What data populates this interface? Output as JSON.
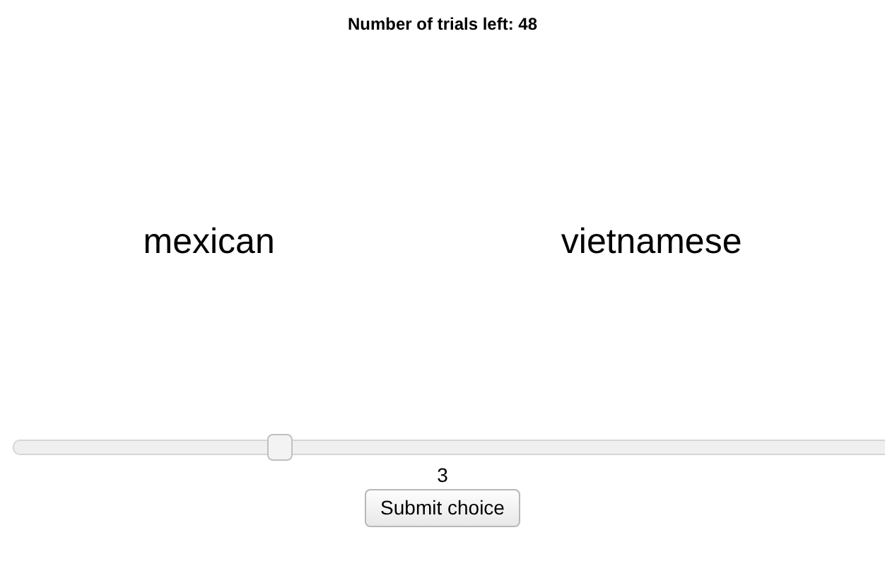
{
  "trials_label": "Number of trials left: 48",
  "options": [
    "mexican",
    "vietnamese"
  ],
  "slider": {
    "level": 0.3,
    "reading": "3"
  },
  "submit_button": "Submit choice"
}
